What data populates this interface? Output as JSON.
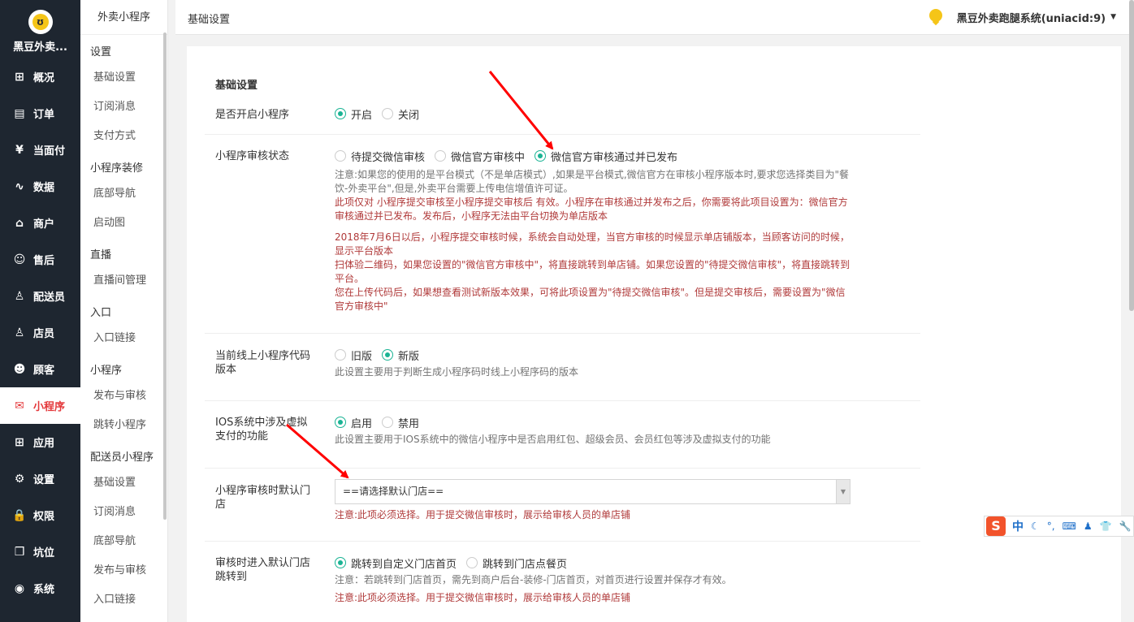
{
  "sidebar": {
    "brand": "黑豆外卖...",
    "items": [
      {
        "label": "概况",
        "icon": "dashboard-icon",
        "glyph": "⊞"
      },
      {
        "label": "订单",
        "icon": "order-icon",
        "glyph": "▤"
      },
      {
        "label": "当面付",
        "icon": "yen-icon",
        "glyph": "¥"
      },
      {
        "label": "数据",
        "icon": "chart-icon",
        "glyph": "∿"
      },
      {
        "label": "商户",
        "icon": "store-icon",
        "glyph": "⌂"
      },
      {
        "label": "售后",
        "icon": "service-icon",
        "glyph": "☺"
      },
      {
        "label": "配送员",
        "icon": "courier-icon",
        "glyph": "♙"
      },
      {
        "label": "店员",
        "icon": "clerk-icon",
        "glyph": "♙"
      },
      {
        "label": "顾客",
        "icon": "customer-icon",
        "glyph": "☻"
      },
      {
        "label": "小程序",
        "icon": "wechat-icon",
        "glyph": "✉"
      },
      {
        "label": "应用",
        "icon": "apps-icon",
        "glyph": "⊞"
      },
      {
        "label": "设置",
        "icon": "gear-icon",
        "glyph": "⚙"
      },
      {
        "label": "权限",
        "icon": "lock-icon",
        "glyph": "🔒"
      },
      {
        "label": "坑位",
        "icon": "cube-icon",
        "glyph": "❒"
      },
      {
        "label": "系统",
        "icon": "system-icon",
        "glyph": "◉"
      }
    ],
    "active_index": 9
  },
  "submenu": {
    "title": "外卖小程序",
    "entries": [
      {
        "type": "group",
        "label": "设置"
      },
      {
        "type": "item",
        "label": "基础设置"
      },
      {
        "type": "item",
        "label": "订阅消息"
      },
      {
        "type": "item",
        "label": "支付方式"
      },
      {
        "type": "group",
        "label": "小程序装修"
      },
      {
        "type": "item",
        "label": "底部导航"
      },
      {
        "type": "item",
        "label": "启动图"
      },
      {
        "type": "group",
        "label": "直播"
      },
      {
        "type": "item",
        "label": "直播间管理"
      },
      {
        "type": "group",
        "label": "入口"
      },
      {
        "type": "item",
        "label": "入口链接"
      },
      {
        "type": "group",
        "label": "小程序"
      },
      {
        "type": "item",
        "label": "发布与审核"
      },
      {
        "type": "item",
        "label": "跳转小程序"
      },
      {
        "type": "group",
        "label": "配送员小程序"
      },
      {
        "type": "item",
        "label": "基础设置"
      },
      {
        "type": "item",
        "label": "订阅消息"
      },
      {
        "type": "item",
        "label": "底部导航"
      },
      {
        "type": "item",
        "label": "发布与审核"
      },
      {
        "type": "item",
        "label": "入口链接"
      }
    ]
  },
  "topbar": {
    "breadcrumb": "基础设置",
    "user": "黑豆外卖跑腿系统(uniacid:9)"
  },
  "form": {
    "section_title": "基础设置",
    "enable": {
      "label": "是否开启小程序",
      "options": [
        "开启",
        "关闭"
      ],
      "selected": 0
    },
    "audit": {
      "label": "小程序审核状态",
      "options": [
        "待提交微信审核",
        "微信官方审核中",
        "微信官方审核通过并已发布"
      ],
      "selected": 2,
      "note": "注意:如果您的使用的是平台模式（不是单店模式）,如果是平台模式,微信官方在审核小程序版本时,要求您选择类目为\"餐饮-外卖平台\",但是,外卖平台需要上传电信增值许可证。",
      "warn1": "此项仅对 小程序提交审核至小程序提交审核后 有效。小程序在审核通过并发布之后，你需要将此项目设置为：微信官方审核通过并已发布。发布后，小程序无法由平台切换为单店版本",
      "warn2": "2018年7月6日以后，小程序提交审核时候，系统会自动处理，当官方审核的时候显示单店铺版本，当顾客访问的时候，显示平台版本",
      "warn3": "扫体验二维码，如果您设置的\"微信官方审核中\"，将直接跳转到单店铺。如果您设置的\"待提交微信审核\"，将直接跳转到平台。",
      "warn4": "您在上传代码后，如果想查看测试新版本效果，可将此项设置为\"待提交微信审核\"。但是提交审核后，需要设置为\"微信官方审核中\""
    },
    "version": {
      "label": "当前线上小程序代码版本",
      "options": [
        "旧版",
        "新版"
      ],
      "selected": 1,
      "help": "此设置主要用于判断生成小程序码时线上小程序码的版本"
    },
    "ios": {
      "label": "IOS系统中涉及虚拟支付的功能",
      "options": [
        "启用",
        "禁用"
      ],
      "selected": 0,
      "help": "此设置主要用于IOS系统中的微信小程序中是否启用红包、超级会员、会员红包等涉及虚拟支付的功能"
    },
    "default_store": {
      "label": "小程序审核时默认门店",
      "value": "==请选择默认门店==",
      "warn": "注意:此项必须选择。用于提交微信审核时，展示给审核人员的单店铺"
    },
    "jump": {
      "label": "审核时进入默认门店跳转到",
      "options": [
        "跳转到自定义门店首页",
        "跳转到门店点餐页"
      ],
      "selected": 0,
      "note": "注意：若跳转到门店首页，需先到商户后台-装修-门店首页，对首页进行设置并保存才有效。",
      "warn": "注意:此项必须选择。用于提交微信审核时，展示给审核人员的单店铺"
    }
  },
  "ime": {
    "logo": "S",
    "lang": "中"
  },
  "colors": {
    "sidebar_bg": "#1e2630",
    "active_red": "#e4393c",
    "radio_green": "#1ab394",
    "warn_text": "#b03a3a",
    "arrow_red": "#ff0000"
  }
}
